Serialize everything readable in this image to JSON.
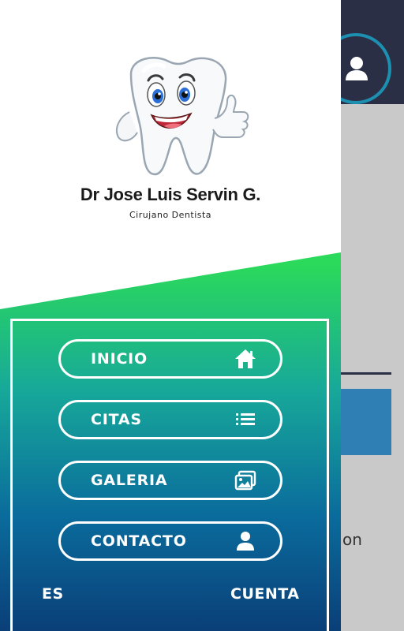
{
  "brand": {
    "name": "Dr Jose Luis Servin G.",
    "subtitle": "Cirujano Dentista",
    "logo_icon": "smiling-tooth-icon"
  },
  "colors": {
    "green": "#2bd95b",
    "teal": "#17a89a",
    "blue": "#0a6b9c",
    "navy": "#0a3f78",
    "header_dark": "#2b2f45"
  },
  "menu": [
    {
      "label": "INICIO",
      "icon": "home-icon"
    },
    {
      "label": "CITAS",
      "icon": "list-icon"
    },
    {
      "label": "GALERIA",
      "icon": "gallery-icon"
    },
    {
      "label": "CONTACTO",
      "icon": "person-icon"
    }
  ],
  "footer": {
    "language": "ES",
    "account": "CUENTA"
  },
  "background": {
    "partial_text": "on",
    "avatar_icon": "user-icon"
  }
}
